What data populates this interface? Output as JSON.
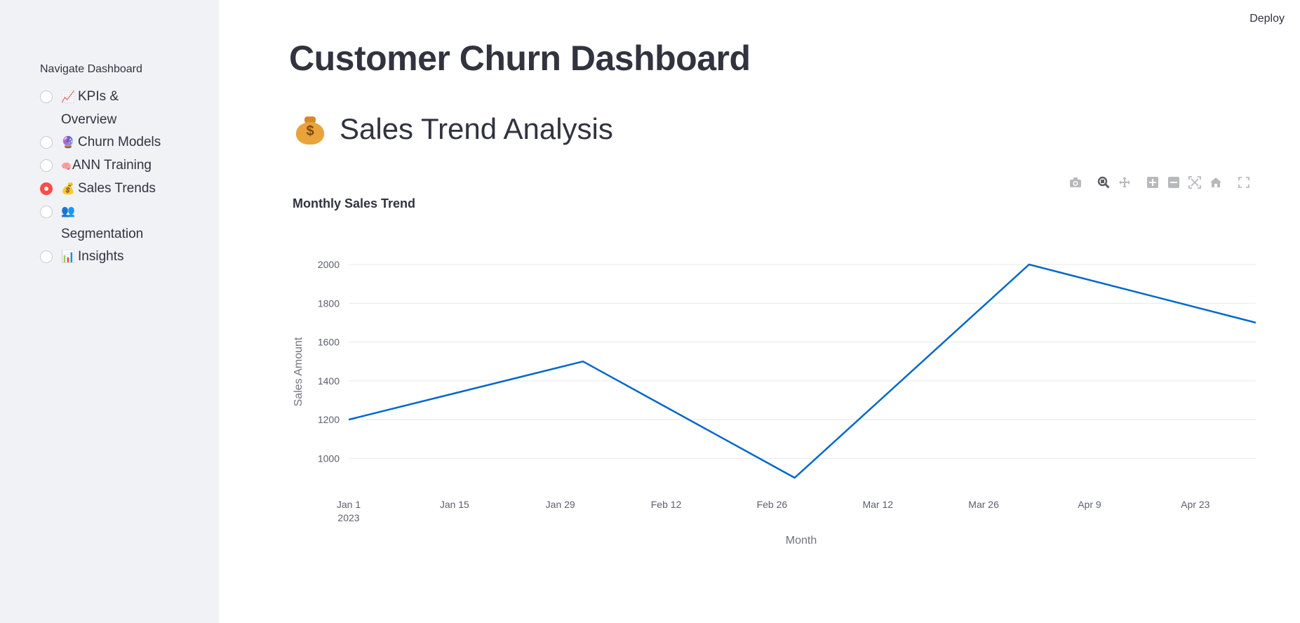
{
  "header": {
    "deploy_label": "Deploy"
  },
  "sidebar": {
    "label": "Navigate Dashboard",
    "items": [
      {
        "icon": "📈",
        "icon_name": "chart-increasing-icon",
        "label": "KPIs & Overview",
        "selected": false
      },
      {
        "icon": "🔮",
        "icon_name": "crystal-ball-icon",
        "label": "Churn Models",
        "selected": false
      },
      {
        "icon": "🧠",
        "icon_name": "brain-icon",
        "label": "ANN Training",
        "selected": false
      },
      {
        "icon": "💰",
        "icon_name": "money-bag-icon",
        "label": "Sales Trends",
        "selected": true
      },
      {
        "icon": "👥",
        "icon_name": "people-icon",
        "label": "Segmentation",
        "selected": false
      },
      {
        "icon": "📊",
        "icon_name": "bar-chart-icon",
        "label": "Insights",
        "selected": false
      }
    ]
  },
  "main": {
    "title": "Customer Churn Dashboard",
    "section_title": "Sales Trend Analysis",
    "section_icon": "money-bag-icon"
  },
  "modebar": {
    "buttons": [
      "camera-icon",
      "zoom-icon",
      "pan-icon",
      "zoom-in-icon",
      "zoom-out-icon",
      "autoscale-icon",
      "reset-axes-icon",
      "fullscreen-icon"
    ],
    "active": "zoom-icon"
  },
  "colors": {
    "line": "#0068c9",
    "accent": "#ff4b4b",
    "sidebar_bg": "#f0f2f6"
  },
  "chart_data": {
    "type": "line",
    "title": "Monthly Sales Trend",
    "xlabel": "Month",
    "ylabel": "Sales Amount",
    "x": [
      "2023-01-01",
      "2023-02-01",
      "2023-03-01",
      "2023-04-01",
      "2023-05-01"
    ],
    "y": [
      1200,
      1500,
      900,
      2000,
      1700
    ],
    "xticks": [
      "Jan 1",
      "Jan 15",
      "Jan 29",
      "Feb 12",
      "Feb 26",
      "Mar 12",
      "Mar 26",
      "Apr 9",
      "Apr 23"
    ],
    "xtick_year": "2023",
    "yticks": [
      1000,
      1200,
      1400,
      1600,
      1800,
      2000
    ],
    "grid": true
  }
}
